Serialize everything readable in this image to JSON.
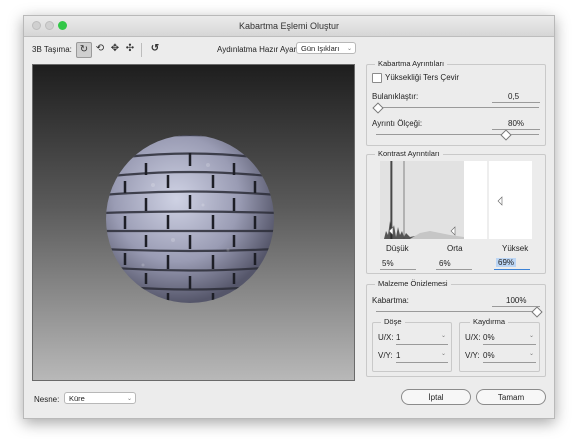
{
  "window": {
    "title": "Kabartma Eşlemi Oluştur"
  },
  "toolbar": {
    "move_label": "3B Taşıma:",
    "lighting_label": "Aydınlatma Hazır Ayarı:",
    "lighting_value": "Gün Işıkları"
  },
  "emboss": {
    "title": "Kabartma Ayrıntıları",
    "invert_label": "Yüksekliği Ters Çevir",
    "invert_checked": false,
    "blur_label": "Bulanıklaştır:",
    "blur_value": "0,5",
    "detail_label": "Ayrıntı Ölçeği:",
    "detail_value": "80%",
    "detail_level": 0.8
  },
  "contrast": {
    "title": "Kontrast Ayrıntıları",
    "low_label": "Düşük",
    "mid_label": "Orta",
    "high_label": "Yüksek",
    "low_value": "5%",
    "mid_value": "6%",
    "high_value": "69%"
  },
  "material": {
    "title": "Malzeme Önizlemesi",
    "roughness_label": "Kabartma:",
    "roughness_value": "100%",
    "roughness_level": 1.0,
    "tile": {
      "title": "Döşe",
      "u_label": "U/X:",
      "u_value": "1",
      "v_label": "V/Y:",
      "v_value": "1"
    },
    "offset": {
      "title": "Kaydırma",
      "u_label": "U/X:",
      "u_value": "0%",
      "v_label": "V/Y:",
      "v_value": "0%"
    }
  },
  "footer": {
    "object_label": "Nesne:",
    "object_value": "Küre",
    "cancel_label": "İptal",
    "ok_label": "Tamam"
  },
  "colors": {
    "accent": "#3b82d6",
    "close": "#f25f58",
    "minimize": "#fbbd2e",
    "zoom": "#33c748"
  }
}
